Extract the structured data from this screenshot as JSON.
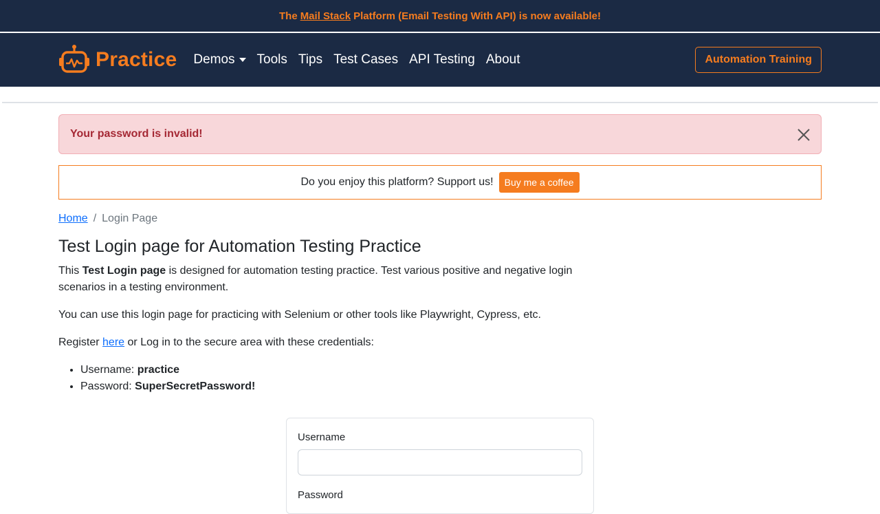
{
  "announcement": {
    "prefix": "The",
    "link": "Mail Stack",
    "suffix": "Platform (Email Testing With API) is now available!"
  },
  "navbar": {
    "brand": "Practice",
    "items": [
      "Demos",
      "Tools",
      "Tips",
      "Test Cases",
      "API Testing",
      "About"
    ],
    "training_button": "Automation Training"
  },
  "alert": {
    "message": "Your password is invalid!"
  },
  "support": {
    "text": "Do you enjoy this platform? Support us!",
    "button": "Buy me a coffee"
  },
  "breadcrumb": {
    "home": "Home",
    "separator": "/",
    "current": "Login Page"
  },
  "page": {
    "title": "Test Login page for Automation Testing Practice",
    "intro_prefix": "This",
    "intro_bold": "Test Login page",
    "intro_suffix": "is designed for automation testing practice. Test various positive and negative login scenarios in a testing environment.",
    "tools_text": "You can use this login page for practicing with Selenium or other tools like Playwright, Cypress, etc.",
    "register_prefix": "Register",
    "register_link": "here",
    "register_suffix": "or Log in to the secure area with these credentials:",
    "username_label": "Username:",
    "username_value": "practice",
    "password_label": "Password:",
    "password_value": "SuperSecretPassword!"
  },
  "form": {
    "username_label": "Username",
    "username_value": "",
    "password_label": "Password"
  },
  "colors": {
    "navbar_bg": "#1b2a44",
    "accent": "#f57c1f",
    "alert_bg": "#f8d7da",
    "alert_text": "#a52834"
  },
  "icons": {
    "logo": "robot-logo-icon",
    "close": "close-icon"
  }
}
